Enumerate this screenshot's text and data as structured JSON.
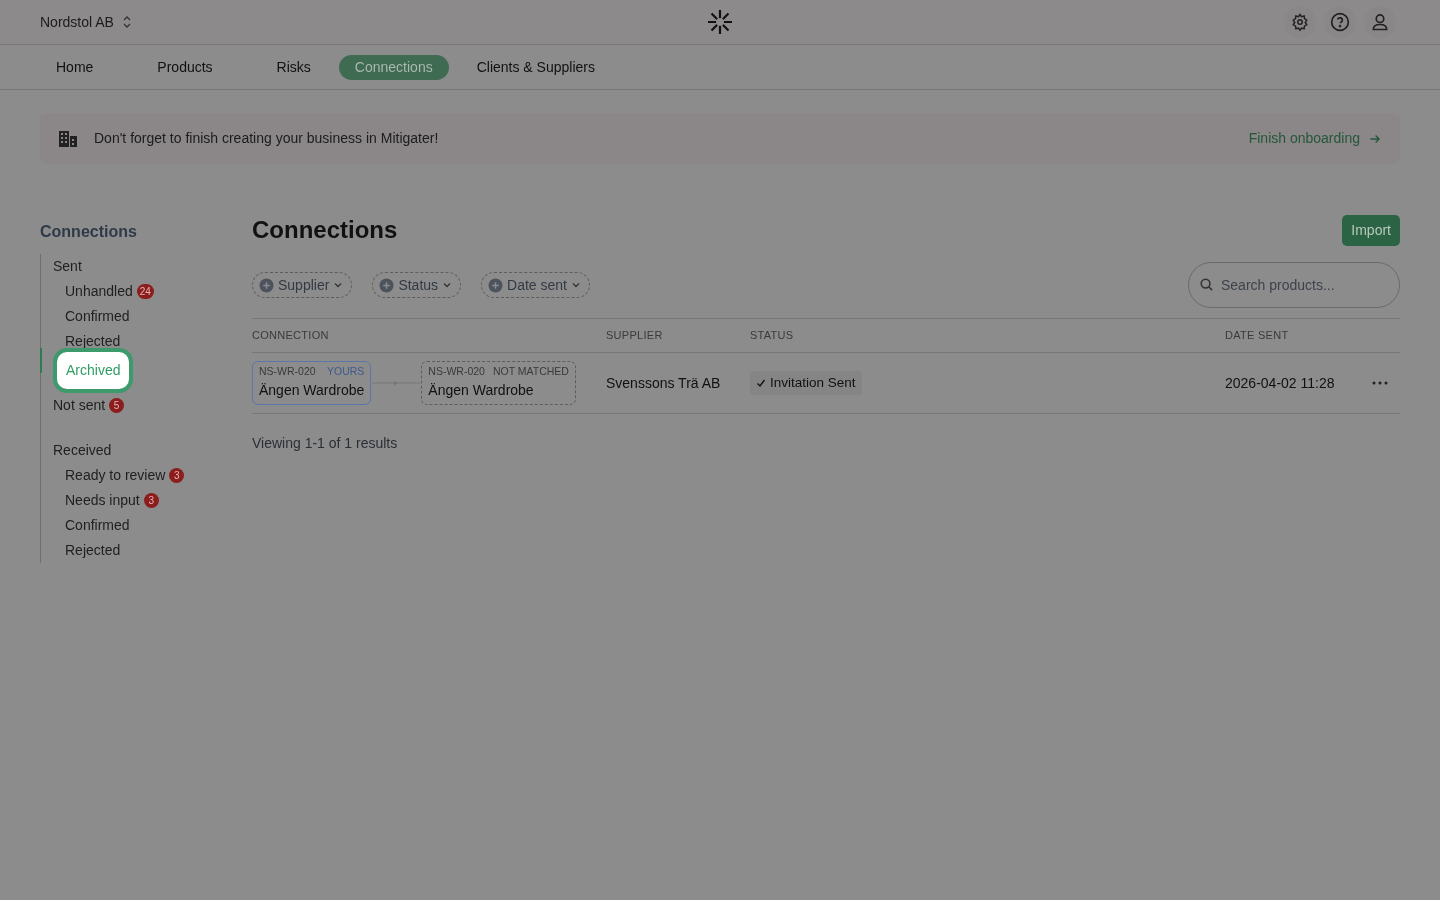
{
  "header": {
    "org": "Nordstol AB"
  },
  "nav": [
    {
      "label": "Home",
      "selected": false
    },
    {
      "label": "Products",
      "selected": false
    },
    {
      "label": "Risks",
      "selected": false
    },
    {
      "label": "Connections",
      "selected": true
    },
    {
      "label": "Clients & Suppliers",
      "selected": false
    }
  ],
  "banner": {
    "message": "Don't forget to finish creating your business in Mitigater!",
    "action": "Finish onboarding"
  },
  "sidebar": {
    "title": "Connections",
    "groups": [
      {
        "label": "Sent",
        "children": [
          {
            "label": "Unhandled",
            "badge": "24",
            "selected": false
          },
          {
            "label": "Confirmed",
            "selected": false
          },
          {
            "label": "Rejected",
            "selected": false
          },
          {
            "label": "Archived",
            "selected": true
          }
        ]
      },
      {
        "label": "Not sent",
        "badge": "5",
        "selected": false
      },
      {
        "label": "Received",
        "children": [
          {
            "label": "Ready to review",
            "badge": "3",
            "selected": false
          },
          {
            "label": "Needs input",
            "badge": "3",
            "selected": false
          },
          {
            "label": "Confirmed",
            "selected": false
          },
          {
            "label": "Rejected",
            "selected": false
          }
        ]
      }
    ]
  },
  "page": {
    "title": "Connections",
    "import_button": "Import",
    "filters": [
      "Supplier",
      "Status",
      "Date sent"
    ],
    "search": {
      "placeholder": "Search products..."
    }
  },
  "table": {
    "columns": [
      "CONNECTION",
      "SUPPLIER",
      "STATUS",
      "DATE SENT"
    ],
    "rows": [
      {
        "yours": {
          "code": "NS-WR-020",
          "tag": "YOURS",
          "name": "Ängen Wardrobe"
        },
        "theirs": {
          "code": "NS-WR-020",
          "tag": "NOT MATCHED",
          "name": "Ängen Wardrobe"
        },
        "supplier": "Svenssons Trä AB",
        "status": "Invitation Sent",
        "date_sent": "2026-04-02 11:28"
      }
    ]
  },
  "footer": "Viewing 1-1 of 1 results"
}
